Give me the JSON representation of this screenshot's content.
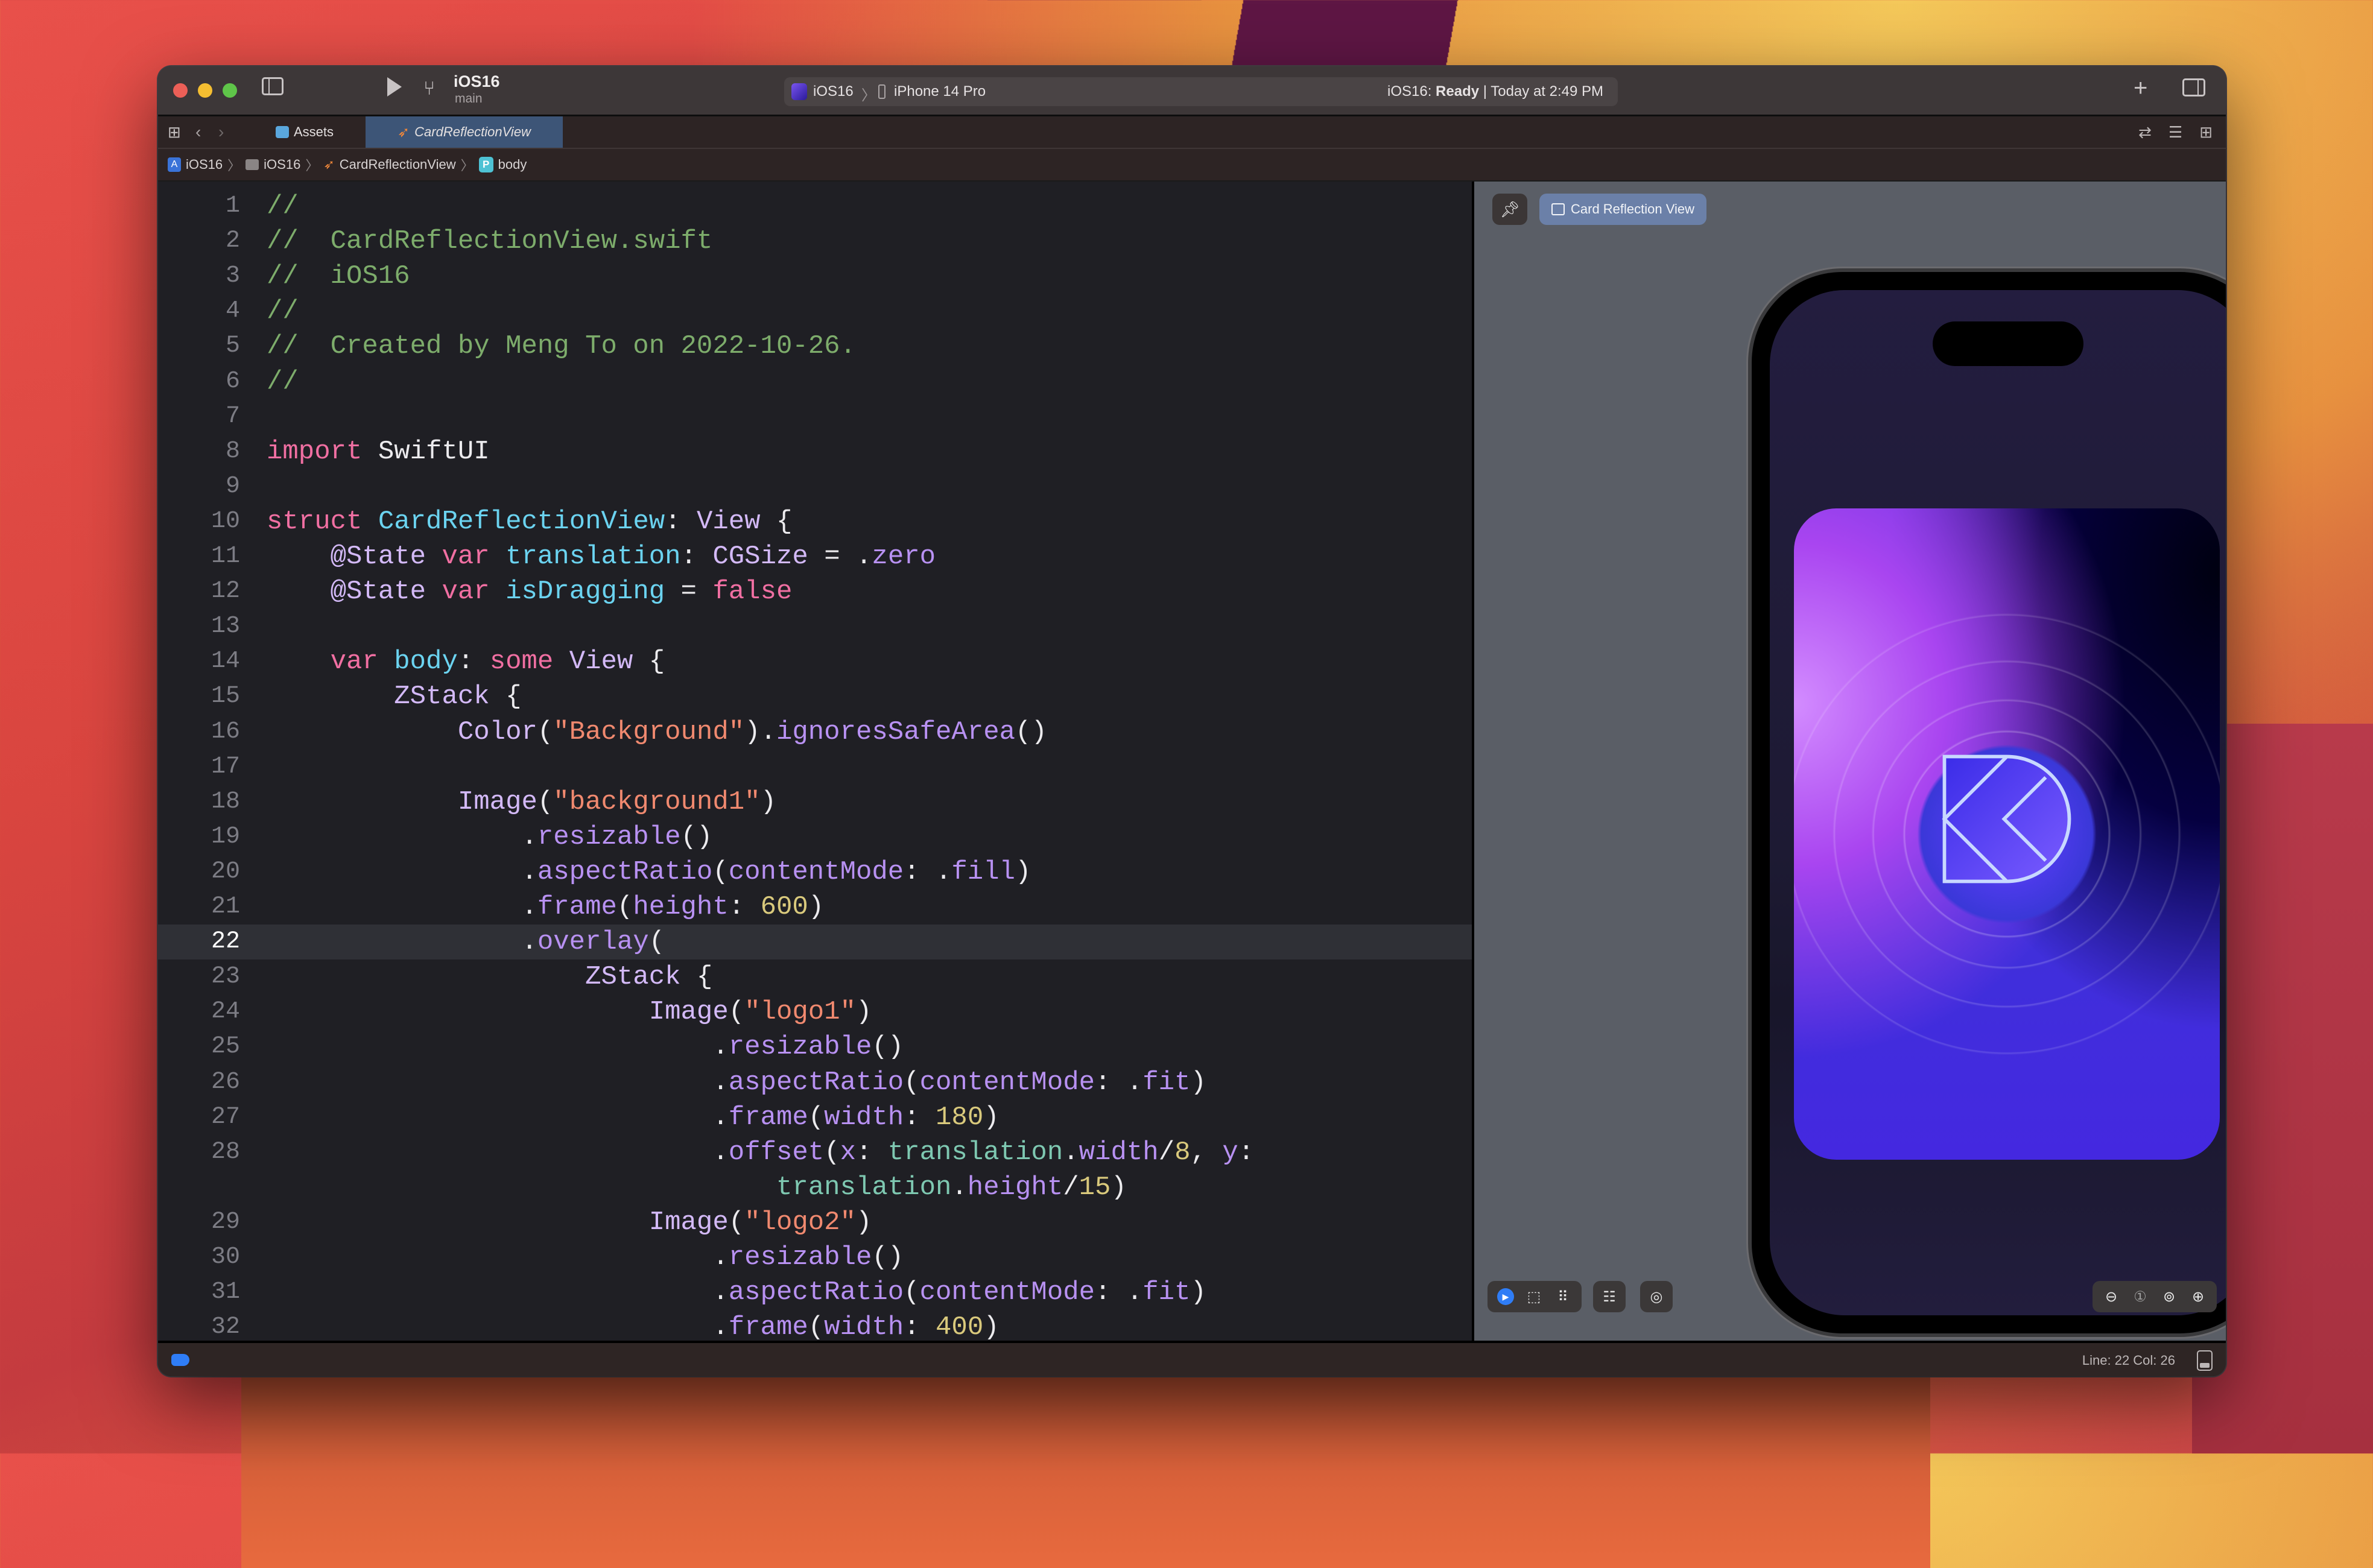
{
  "titlebar": {
    "project": "iOS16",
    "branch": "main",
    "scheme": "iOS16",
    "destination": "iPhone 14 Pro",
    "status_prefix": "iOS16:",
    "status_state": "Ready",
    "status_time": "Today at 2:49 PM"
  },
  "tabs": [
    {
      "label": "Assets",
      "icon": "asset-catalog-icon",
      "active": false
    },
    {
      "label": "CardReflectionView",
      "icon": "swift-icon",
      "active": true
    }
  ],
  "breadcrumb": [
    {
      "label": "iOS16",
      "icon": "project-icon"
    },
    {
      "label": "iOS16",
      "icon": "folder-icon"
    },
    {
      "label": "CardReflectionView",
      "icon": "swift-icon"
    },
    {
      "label": "body",
      "icon": "property-icon"
    }
  ],
  "editor": {
    "current_line": 22,
    "lines": [
      {
        "n": "1",
        "tokens": [
          [
            "c-com",
            "//"
          ]
        ]
      },
      {
        "n": "2",
        "tokens": [
          [
            "c-com",
            "//  CardReflectionView.swift"
          ]
        ]
      },
      {
        "n": "3",
        "tokens": [
          [
            "c-com",
            "//  iOS16"
          ]
        ]
      },
      {
        "n": "4",
        "tokens": [
          [
            "c-com",
            "//"
          ]
        ]
      },
      {
        "n": "5",
        "tokens": [
          [
            "c-com",
            "//  Created by Meng To on 2022-10-26."
          ]
        ]
      },
      {
        "n": "6",
        "tokens": [
          [
            "c-com",
            "//"
          ]
        ]
      },
      {
        "n": "7",
        "tokens": []
      },
      {
        "n": "8",
        "tokens": [
          [
            "c-kw",
            "import"
          ],
          [
            "c-plain",
            " SwiftUI"
          ]
        ]
      },
      {
        "n": "9",
        "tokens": []
      },
      {
        "n": "10",
        "tokens": [
          [
            "c-kw",
            "struct"
          ],
          [
            "c-plain",
            " "
          ],
          [
            "c-decl",
            "CardReflectionView"
          ],
          [
            "c-plain",
            ": "
          ],
          [
            "c-type",
            "View"
          ],
          [
            "c-plain",
            " {"
          ]
        ]
      },
      {
        "n": "11",
        "tokens": [
          [
            "c-plain",
            "    "
          ],
          [
            "c-type",
            "@State"
          ],
          [
            "c-plain",
            " "
          ],
          [
            "c-kw",
            "var"
          ],
          [
            "c-plain",
            " "
          ],
          [
            "c-decl",
            "translation"
          ],
          [
            "c-plain",
            ": "
          ],
          [
            "c-type",
            "CGSize"
          ],
          [
            "c-plain",
            " = ."
          ],
          [
            "c-fn",
            "zero"
          ]
        ]
      },
      {
        "n": "12",
        "tokens": [
          [
            "c-plain",
            "    "
          ],
          [
            "c-type",
            "@State"
          ],
          [
            "c-plain",
            " "
          ],
          [
            "c-kw",
            "var"
          ],
          [
            "c-plain",
            " "
          ],
          [
            "c-decl",
            "isDragging"
          ],
          [
            "c-plain",
            " = "
          ],
          [
            "c-kw",
            "false"
          ]
        ]
      },
      {
        "n": "13",
        "tokens": []
      },
      {
        "n": "14",
        "tokens": [
          [
            "c-plain",
            "    "
          ],
          [
            "c-kw",
            "var"
          ],
          [
            "c-plain",
            " "
          ],
          [
            "c-decl",
            "body"
          ],
          [
            "c-plain",
            ": "
          ],
          [
            "c-kw",
            "some"
          ],
          [
            "c-plain",
            " "
          ],
          [
            "c-type",
            "View"
          ],
          [
            "c-plain",
            " {"
          ]
        ]
      },
      {
        "n": "15",
        "tokens": [
          [
            "c-plain",
            "        "
          ],
          [
            "c-type",
            "ZStack"
          ],
          [
            "c-plain",
            " {"
          ]
        ]
      },
      {
        "n": "16",
        "tokens": [
          [
            "c-plain",
            "            "
          ],
          [
            "c-type",
            "Color"
          ],
          [
            "c-plain",
            "("
          ],
          [
            "c-str",
            "\"Background\""
          ],
          [
            "c-plain",
            ")."
          ],
          [
            "c-fn",
            "ignoresSafeArea"
          ],
          [
            "c-plain",
            "()"
          ]
        ]
      },
      {
        "n": "17",
        "tokens": []
      },
      {
        "n": "18",
        "tokens": [
          [
            "c-plain",
            "            "
          ],
          [
            "c-type",
            "Image"
          ],
          [
            "c-plain",
            "("
          ],
          [
            "c-str",
            "\"background1\""
          ],
          [
            "c-plain",
            ")"
          ]
        ]
      },
      {
        "n": "19",
        "tokens": [
          [
            "c-plain",
            "                ."
          ],
          [
            "c-fn",
            "resizable"
          ],
          [
            "c-plain",
            "()"
          ]
        ]
      },
      {
        "n": "20",
        "tokens": [
          [
            "c-plain",
            "                ."
          ],
          [
            "c-fn",
            "aspectRatio"
          ],
          [
            "c-plain",
            "("
          ],
          [
            "c-fn",
            "contentMode"
          ],
          [
            "c-plain",
            ": ."
          ],
          [
            "c-fn",
            "fill"
          ],
          [
            "c-plain",
            ")"
          ]
        ]
      },
      {
        "n": "21",
        "tokens": [
          [
            "c-plain",
            "                ."
          ],
          [
            "c-fn",
            "frame"
          ],
          [
            "c-plain",
            "("
          ],
          [
            "c-fn",
            "height"
          ],
          [
            "c-plain",
            ": "
          ],
          [
            "c-num",
            "600"
          ],
          [
            "c-plain",
            ")"
          ]
        ]
      },
      {
        "n": "22",
        "tokens": [
          [
            "c-plain",
            "                ."
          ],
          [
            "c-fn",
            "overlay"
          ],
          [
            "c-plain",
            "("
          ]
        ]
      },
      {
        "n": "23",
        "tokens": [
          [
            "c-plain",
            "                    "
          ],
          [
            "c-type",
            "ZStack"
          ],
          [
            "c-plain",
            " {"
          ]
        ]
      },
      {
        "n": "24",
        "tokens": [
          [
            "c-plain",
            "                        "
          ],
          [
            "c-type",
            "Image"
          ],
          [
            "c-plain",
            "("
          ],
          [
            "c-str",
            "\"logo1\""
          ],
          [
            "c-plain",
            ")"
          ]
        ]
      },
      {
        "n": "25",
        "tokens": [
          [
            "c-plain",
            "                            ."
          ],
          [
            "c-fn",
            "resizable"
          ],
          [
            "c-plain",
            "()"
          ]
        ]
      },
      {
        "n": "26",
        "tokens": [
          [
            "c-plain",
            "                            ."
          ],
          [
            "c-fn",
            "aspectRatio"
          ],
          [
            "c-plain",
            "("
          ],
          [
            "c-fn",
            "contentMode"
          ],
          [
            "c-plain",
            ": ."
          ],
          [
            "c-fn",
            "fit"
          ],
          [
            "c-plain",
            ")"
          ]
        ]
      },
      {
        "n": "27",
        "tokens": [
          [
            "c-plain",
            "                            ."
          ],
          [
            "c-fn",
            "frame"
          ],
          [
            "c-plain",
            "("
          ],
          [
            "c-fn",
            "width"
          ],
          [
            "c-plain",
            ": "
          ],
          [
            "c-num",
            "180"
          ],
          [
            "c-plain",
            ")"
          ]
        ]
      },
      {
        "n": "28",
        "tokens": [
          [
            "c-plain",
            "                            ."
          ],
          [
            "c-fn",
            "offset"
          ],
          [
            "c-plain",
            "("
          ],
          [
            "c-fn",
            "x"
          ],
          [
            "c-plain",
            ": "
          ],
          [
            "c-var",
            "translation"
          ],
          [
            "c-plain",
            "."
          ],
          [
            "c-fn",
            "width"
          ],
          [
            "c-plain",
            "/"
          ],
          [
            "c-num",
            "8"
          ],
          [
            "c-plain",
            ", "
          ],
          [
            "c-fn",
            "y"
          ],
          [
            "c-plain",
            ":"
          ]
        ]
      },
      {
        "n": "",
        "tokens": [
          [
            "c-plain",
            "                                "
          ],
          [
            "c-var",
            "translation"
          ],
          [
            "c-plain",
            "."
          ],
          [
            "c-fn",
            "height"
          ],
          [
            "c-plain",
            "/"
          ],
          [
            "c-num",
            "15"
          ],
          [
            "c-plain",
            ")"
          ]
        ]
      },
      {
        "n": "29",
        "tokens": [
          [
            "c-plain",
            "                        "
          ],
          [
            "c-type",
            "Image"
          ],
          [
            "c-plain",
            "("
          ],
          [
            "c-str",
            "\"logo2\""
          ],
          [
            "c-plain",
            ")"
          ]
        ]
      },
      {
        "n": "30",
        "tokens": [
          [
            "c-plain",
            "                            ."
          ],
          [
            "c-fn",
            "resizable"
          ],
          [
            "c-plain",
            "()"
          ]
        ]
      },
      {
        "n": "31",
        "tokens": [
          [
            "c-plain",
            "                            ."
          ],
          [
            "c-fn",
            "aspectRatio"
          ],
          [
            "c-plain",
            "("
          ],
          [
            "c-fn",
            "contentMode"
          ],
          [
            "c-plain",
            ": ."
          ],
          [
            "c-fn",
            "fit"
          ],
          [
            "c-plain",
            ")"
          ]
        ]
      },
      {
        "n": "32",
        "tokens": [
          [
            "c-plain",
            "                            ."
          ],
          [
            "c-fn",
            "frame"
          ],
          [
            "c-plain",
            "("
          ],
          [
            "c-fn",
            "width"
          ],
          [
            "c-plain",
            ": "
          ],
          [
            "c-num",
            "400"
          ],
          [
            "c-plain",
            ")"
          ]
        ]
      }
    ]
  },
  "preview": {
    "chip_label": "Card Reflection View",
    "device": "iPhone 14 Pro",
    "live_mode_active": true
  },
  "statusbar": {
    "position": "Line: 22  Col: 26"
  },
  "colors": {
    "accent": "#2f7df6",
    "active_tab": "#3d5577",
    "preview_chip": "#6b80a8"
  }
}
